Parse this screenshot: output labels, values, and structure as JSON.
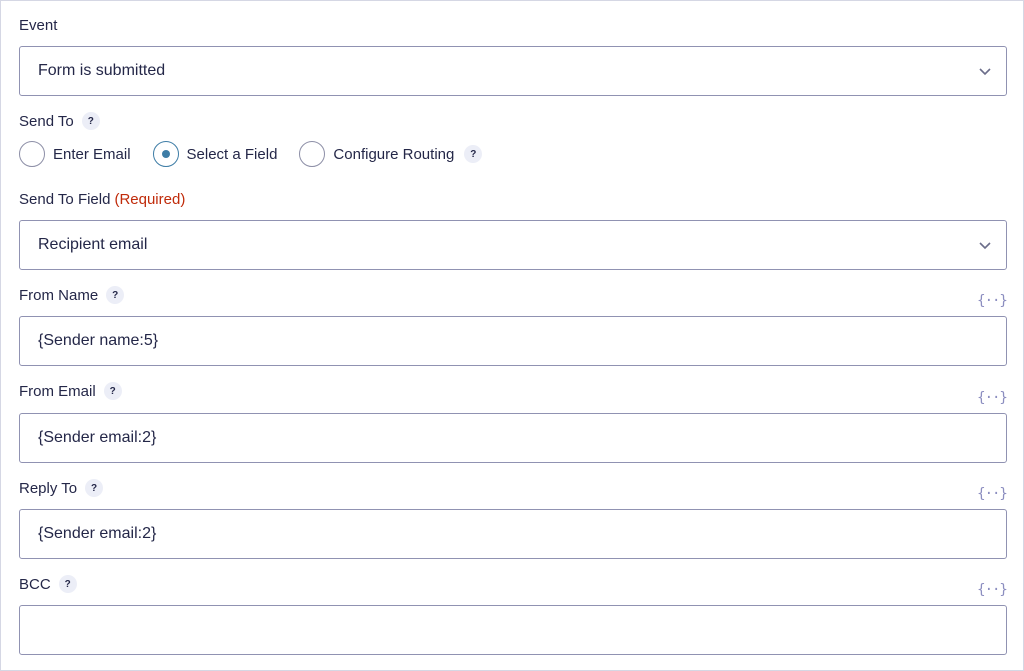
{
  "event": {
    "label": "Event",
    "value": "Form is submitted"
  },
  "send_to": {
    "label": "Send To",
    "help": "?",
    "options": [
      {
        "label": "Enter Email",
        "checked": false
      },
      {
        "label": "Select a Field",
        "checked": true
      },
      {
        "label": "Configure Routing",
        "checked": false
      }
    ],
    "routing_help": "?"
  },
  "send_to_field": {
    "label": "Send To Field",
    "required": "(Required)",
    "value": "Recipient email"
  },
  "from_name": {
    "label": "From Name",
    "help": "?",
    "merge_tag": "{··}",
    "value": "{Sender name:5}"
  },
  "from_email": {
    "label": "From Email",
    "help": "?",
    "merge_tag": "{··}",
    "value": "{Sender email:2}"
  },
  "reply_to": {
    "label": "Reply To",
    "help": "?",
    "merge_tag": "{··}",
    "value": "{Sender email:2}"
  },
  "bcc": {
    "label": "BCC",
    "help": "?",
    "merge_tag": "{··}",
    "value": ""
  }
}
